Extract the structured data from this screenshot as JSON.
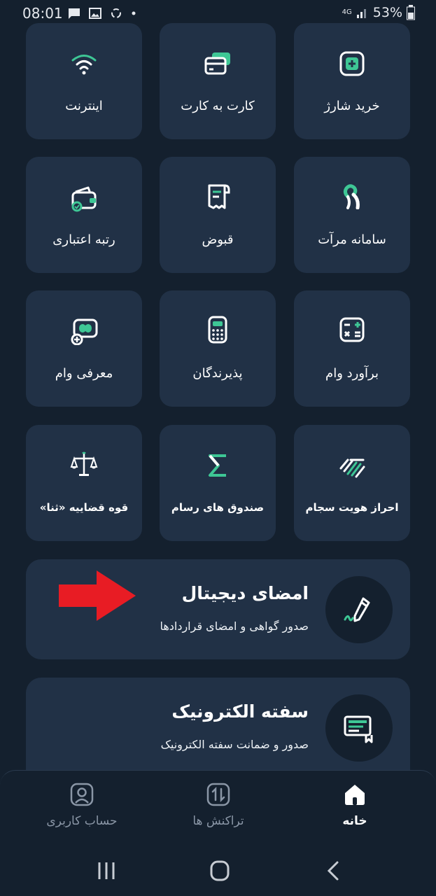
{
  "status_bar": {
    "time": "08:01",
    "network": "4G",
    "battery": "53%",
    "icons": [
      "message-icon",
      "gallery-icon",
      "sync-icon",
      "dot-icon",
      "signal-icon",
      "battery-icon"
    ]
  },
  "tiles": [
    {
      "name": "tile-buy-charge",
      "label": "خرید شارژ",
      "icon": "sim-card-plus-icon"
    },
    {
      "name": "tile-card-to-card",
      "label": "کارت به کارت",
      "icon": "cards-icon"
    },
    {
      "name": "tile-internet",
      "label": "اینترنت",
      "icon": "wifi-icon"
    },
    {
      "name": "tile-merat",
      "label": "سامانه مرآت",
      "icon": "merat-logo-icon"
    },
    {
      "name": "tile-bills",
      "label": "قبوض",
      "icon": "receipt-icon"
    },
    {
      "name": "tile-credit-rating",
      "label": "رتبه اعتباری",
      "icon": "wallet-check-icon"
    },
    {
      "name": "tile-loan-estimate",
      "label": "برآورد وام",
      "icon": "calculator-icon"
    },
    {
      "name": "tile-acceptors",
      "label": "پذیرندگان",
      "icon": "pos-terminal-icon"
    },
    {
      "name": "tile-loan-introduce",
      "label": "معرفی وام",
      "icon": "money-plus-icon"
    },
    {
      "name": "tile-sejam",
      "label": "احراز هویت سجام",
      "icon": "sejam-logo-icon"
    },
    {
      "name": "tile-rasam-funds",
      "label": "صندوق های رسام",
      "icon": "sigma-icon"
    },
    {
      "name": "tile-judiciary",
      "label": "قوه قضاییه «ثنا»",
      "icon": "scales-icon"
    }
  ],
  "cards": [
    {
      "title": "امضای دیجیتال",
      "subtitle": "صدور گواهی و امضای قراردادها",
      "icon": "pen-signature-icon"
    },
    {
      "title": "سفته الکترونیک",
      "subtitle": "صدور و ضمانت سفته الکترونیک",
      "icon": "promissory-note-icon"
    }
  ],
  "bottom_nav": {
    "home": "خانه",
    "transactions": "تراکنش ها",
    "account": "حساب کاربری",
    "active": "home"
  },
  "colors": {
    "background": "#14202e",
    "tile": "#213146",
    "accent": "#3ec795",
    "arrow": "#e81c24",
    "inactive": "#8a96a6"
  }
}
